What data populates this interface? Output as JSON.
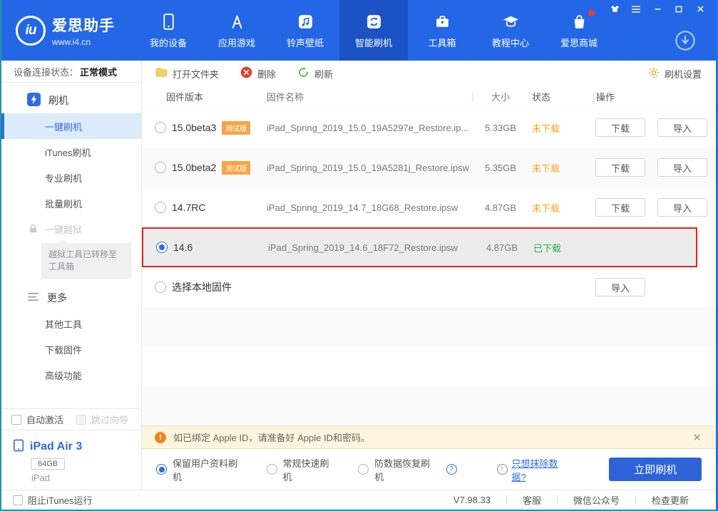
{
  "colors": {
    "accent": "#2467e6",
    "warning_orange": "#f5a623",
    "success_green": "#23b14d",
    "selected_border_red": "#e2241c"
  },
  "titlebar": {
    "logo_monogram": "iu",
    "logo_title": "爱思助手",
    "logo_url": "www.i4.cn",
    "nav": [
      {
        "name": "my-devices",
        "icon": "phone-icon",
        "label": "我的设备",
        "active": false
      },
      {
        "name": "apps-games",
        "icon": "appstore-icon",
        "label": "应用游戏",
        "active": false
      },
      {
        "name": "ringtones-wallpapers",
        "icon": "music-icon",
        "label": "铃声壁纸",
        "active": false
      },
      {
        "name": "smart-flash",
        "icon": "sync-icon",
        "label": "智能刷机",
        "active": true
      },
      {
        "name": "toolbox",
        "icon": "toolbox-icon",
        "label": "工具箱",
        "active": false
      },
      {
        "name": "tutorials",
        "icon": "tutorial-icon",
        "label": "教程中心",
        "active": false
      },
      {
        "name": "store",
        "icon": "store-icon",
        "label": "爱思商城",
        "active": false,
        "dot": true
      }
    ],
    "window_controls": [
      {
        "name": "skin",
        "icon": "shirt-icon"
      },
      {
        "name": "menu",
        "icon": "list-icon"
      },
      {
        "name": "minimize",
        "icon": "minimize-icon"
      },
      {
        "name": "maximize",
        "icon": "maximize-icon"
      },
      {
        "name": "close",
        "icon": "close-icon"
      }
    ]
  },
  "sidebar": {
    "device_status_label": "设备连接状态：",
    "device_status_value": "正常模式",
    "menu": [
      {
        "type": "section",
        "name": "flash",
        "icon": "flash-icon",
        "label": "刷机"
      },
      {
        "type": "item",
        "name": "one-click-flash",
        "label": "一键刷机",
        "active": true
      },
      {
        "type": "item",
        "name": "itunes-flash",
        "label": "iTunes刷机"
      },
      {
        "type": "item",
        "name": "pro-flash",
        "label": "专业刷机"
      },
      {
        "type": "item",
        "name": "batch-flash",
        "label": "批量刷机"
      },
      {
        "type": "disabled",
        "name": "one-click-jailbreak",
        "icon": "lock-icon",
        "label": "一键越狱"
      },
      {
        "type": "note",
        "name": "jailbreak-note",
        "label": "越狱工具已转移至工具箱"
      },
      {
        "type": "section",
        "name": "more",
        "icon": "more-icon",
        "label": "更多"
      },
      {
        "type": "item",
        "name": "other-tools",
        "label": "其他工具"
      },
      {
        "type": "item",
        "name": "download-firmware",
        "label": "下载固件"
      },
      {
        "type": "item",
        "name": "advanced-features",
        "label": "高级功能"
      }
    ],
    "auto_activate_label": "自动激活",
    "skip_wizard_label": "跳过向导",
    "device_name": "iPad Air 3",
    "device_capacity": "64GB",
    "device_type": "iPad"
  },
  "toolbar": {
    "open_folder": "打开文件夹",
    "delete": "删除",
    "refresh": "刷新",
    "flash_settings": "刷机设置"
  },
  "table": {
    "headers": [
      "固件版本",
      "固件名称",
      "大小",
      "状态",
      "操作"
    ],
    "rows": [
      {
        "version": "15.0beta3",
        "badge": "测试版",
        "name": "iPad_Spring_2019_15.0_19A5297e_Restore.ip...",
        "size": "5.33GB",
        "status": "未下载",
        "status_type": "not_downloaded",
        "actions": [
          "下载",
          "导入"
        ],
        "selected": false
      },
      {
        "version": "15.0beta2",
        "badge": "测试版",
        "name": "iPad_Spring_2019_15.0_19A5281j_Restore.ipsw",
        "size": "5.35GB",
        "status": "未下载",
        "status_type": "not_downloaded",
        "actions": [
          "下载",
          "导入"
        ],
        "selected": false
      },
      {
        "version": "14.7RC",
        "badge": null,
        "name": "iPad_Spring_2019_14.7_18G68_Restore.ipsw",
        "size": "4.87GB",
        "status": "未下载",
        "status_type": "not_downloaded",
        "actions": [
          "下载",
          "导入"
        ],
        "selected": false
      },
      {
        "version": "14.6",
        "badge": null,
        "name": "iPad_Spring_2019_14.6_18F72_Restore.ipsw",
        "size": "4.87GB",
        "status": "已下载",
        "status_type": "downloaded",
        "actions": [],
        "selected": true
      },
      {
        "version": "选择本地固件",
        "badge": null,
        "name": "",
        "size": "",
        "status": "",
        "status_type": "",
        "actions": [
          "导入"
        ],
        "selected": false
      }
    ]
  },
  "notice": {
    "text": "如已绑定 Apple ID，请准备好 Apple ID和密码。"
  },
  "options": {
    "radios": [
      {
        "name": "keep-user-data",
        "label": "保留用户资料刷机",
        "selected": true,
        "help": false
      },
      {
        "name": "normal-quick-flash",
        "label": "常规快速刷机",
        "selected": false,
        "help": false
      },
      {
        "name": "anti-data-recovery-flash",
        "label": "防数据恢复刷机",
        "selected": false,
        "help": true
      }
    ],
    "erase_link": "只想抹除数据?",
    "flash_button": "立即刷机"
  },
  "statusbar": {
    "block_itunes_label": "阻止iTunes运行",
    "version": "V7.98.33",
    "links": [
      "客服",
      "微信公众号",
      "检查更新"
    ]
  }
}
